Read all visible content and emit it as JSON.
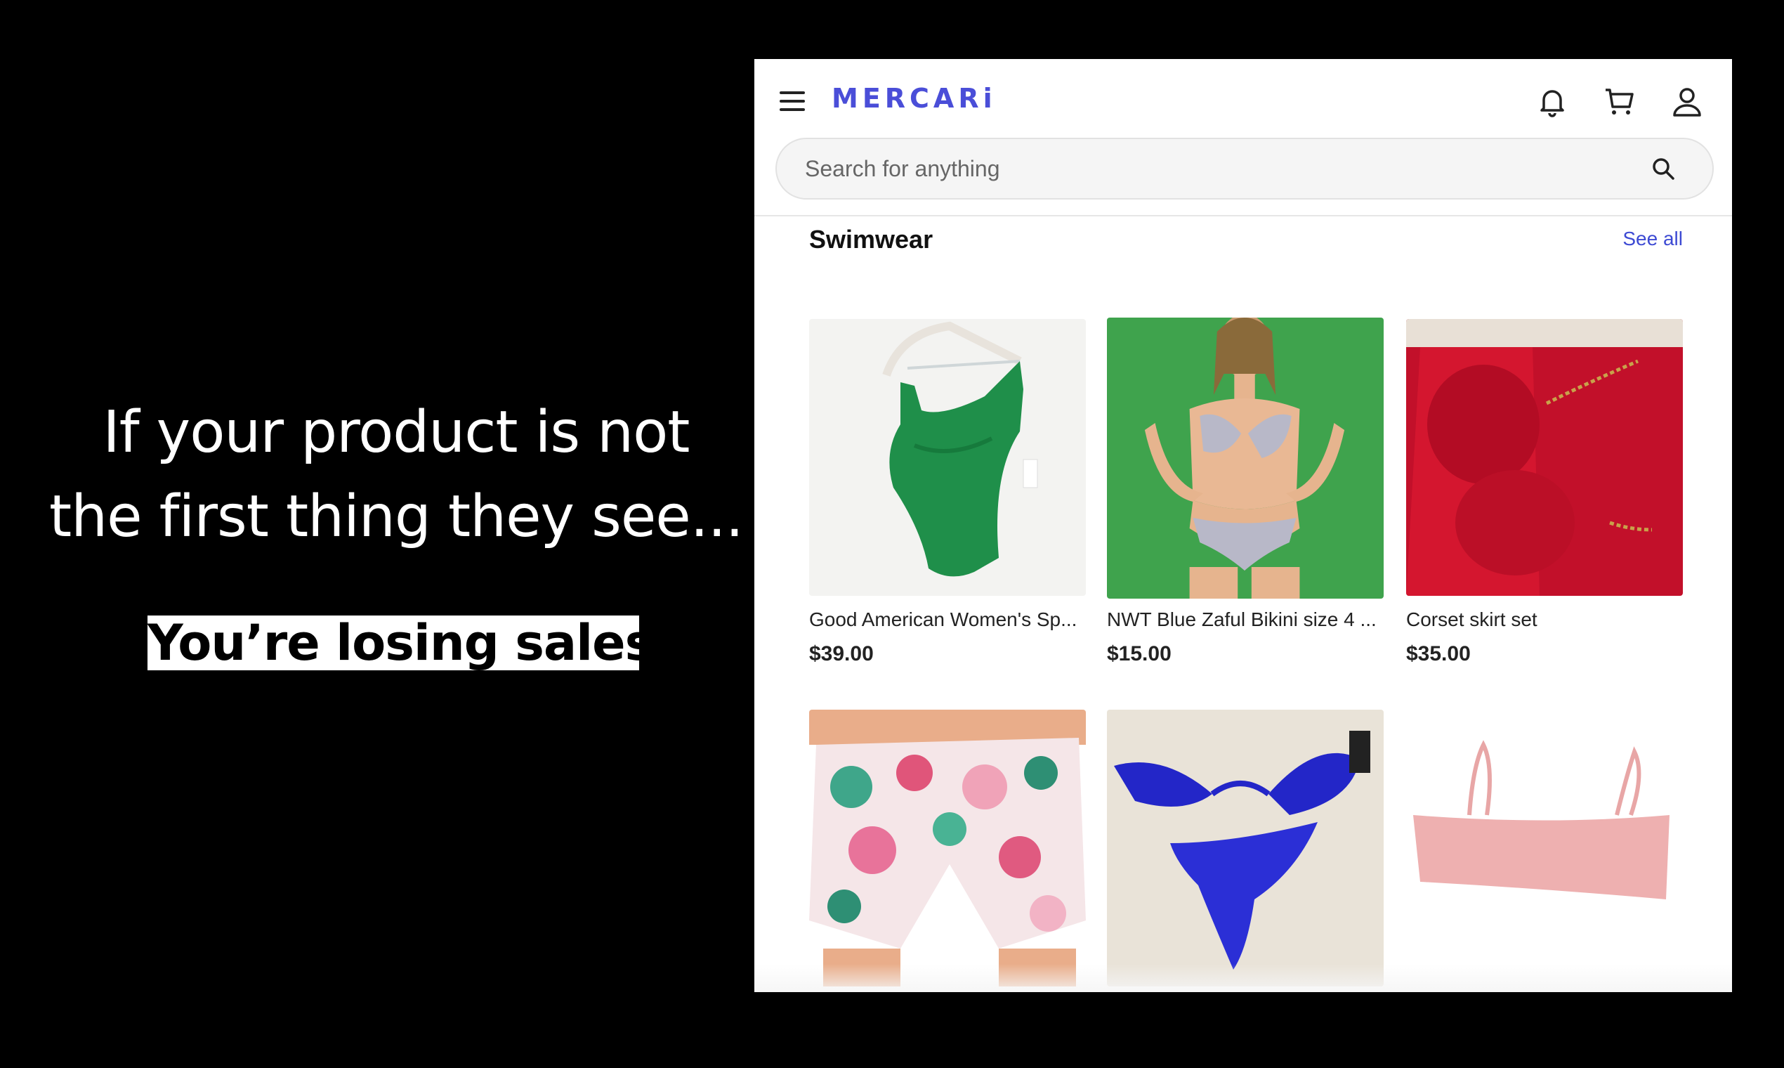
{
  "promo": {
    "line1": "If your product is not",
    "line2": "the first thing they see...",
    "highlight": "You’re losing sales."
  },
  "header": {
    "logo": "MERCARi",
    "icons": [
      "menu-icon",
      "bell-icon",
      "cart-icon",
      "user-icon"
    ],
    "brand_color": "#4a4ed8"
  },
  "search": {
    "placeholder": "Search for anything"
  },
  "section": {
    "title": "Swimwear",
    "see_all": "See all"
  },
  "products": [
    {
      "title": "Good American Women's Sp...",
      "price": "$39.00",
      "image": "green one-shoulder swimsuit on hanger"
    },
    {
      "title": "NWT Blue Zaful Bikini size 4 ...",
      "price": "$15.00",
      "image": "model in printed bikini on green background"
    },
    {
      "title": "Corset skirt set",
      "price": "$35.00",
      "image": "red corset top and skirt"
    },
    {
      "title": "",
      "price": "",
      "image": "floral print shorts"
    },
    {
      "title": "",
      "price": "",
      "image": "blue bikini on fur rug"
    },
    {
      "title": "",
      "price": "",
      "image": "pink bandeau bikini top"
    }
  ]
}
